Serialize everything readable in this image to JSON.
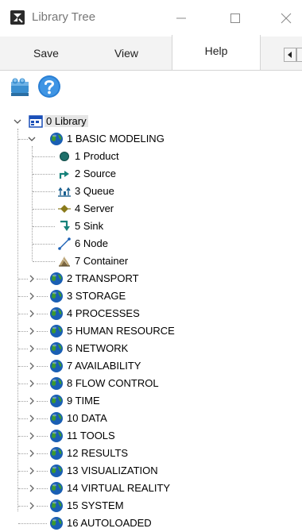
{
  "window": {
    "title": "Library Tree",
    "controls": [
      "minimize-icon",
      "maximize-icon",
      "close-icon"
    ]
  },
  "tabs": [
    {
      "label": "Save",
      "active": false
    },
    {
      "label": "View",
      "active": false
    },
    {
      "label": "Help",
      "active": true
    }
  ],
  "toolbar": {
    "buttons": [
      "library-blocks-icon",
      "help-question-icon"
    ]
  },
  "tree": {
    "root": {
      "label": "0 Library",
      "expanded": true,
      "icon": "library-window-icon",
      "selected": true
    },
    "basic_modeling": {
      "label": "1 BASIC MODELING",
      "expanded": true,
      "icon": "globe-icon",
      "children": [
        {
          "label": "1 Product",
          "icon": "product-circle-icon"
        },
        {
          "label": "2 Source",
          "icon": "source-arrow-icon"
        },
        {
          "label": "3 Queue",
          "icon": "queue-icon"
        },
        {
          "label": "4 Server",
          "icon": "server-diamond-icon"
        },
        {
          "label": "5 Sink",
          "icon": "sink-arrow-icon"
        },
        {
          "label": "6 Node",
          "icon": "node-line-icon"
        },
        {
          "label": "7 Container",
          "icon": "container-icon"
        }
      ]
    },
    "folders": [
      {
        "label": "2 TRANSPORT",
        "icon": "globe-icon"
      },
      {
        "label": "3 STORAGE",
        "icon": "globe-icon"
      },
      {
        "label": "4 PROCESSES",
        "icon": "globe-icon"
      },
      {
        "label": "5 HUMAN RESOURCE",
        "icon": "globe-icon"
      },
      {
        "label": "6 NETWORK",
        "icon": "globe-icon"
      },
      {
        "label": "7 AVAILABILITY",
        "icon": "globe-icon"
      },
      {
        "label": "8 FLOW CONTROL",
        "icon": "globe-icon"
      },
      {
        "label": "9 TIME",
        "icon": "globe-icon"
      },
      {
        "label": "10 DATA",
        "icon": "globe-icon"
      },
      {
        "label": "11 TOOLS",
        "icon": "globe-icon"
      },
      {
        "label": "12 RESULTS",
        "icon": "globe-icon"
      },
      {
        "label": "13 VISUALIZATION",
        "icon": "globe-icon"
      },
      {
        "label": "14 VIRTUAL REALITY",
        "icon": "globe-icon"
      },
      {
        "label": "15 SYSTEM",
        "icon": "globe-icon"
      }
    ],
    "last_folder": {
      "label": "16 AUTOLOADED",
      "icon": "globe-icon"
    }
  },
  "colors": {
    "selection": "#e5e5e5",
    "globe_blue": "#1a5fb4",
    "globe_green": "#3c9a2f",
    "product_teal": "#1f6f6a",
    "server_olive": "#8a7a1a",
    "sink_teal": "#16827a"
  }
}
